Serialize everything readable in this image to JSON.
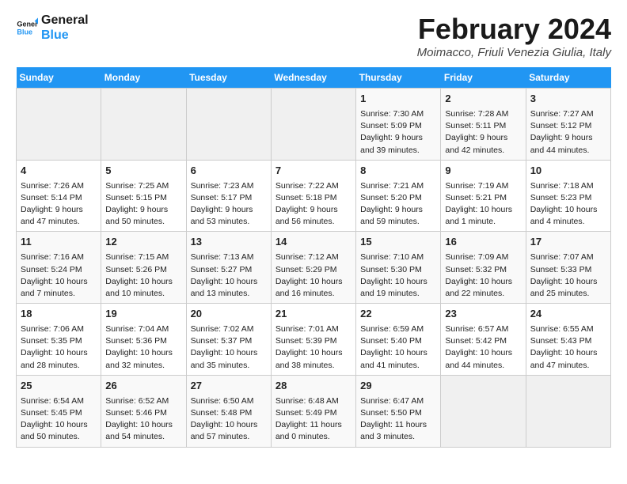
{
  "logo": {
    "line1": "General",
    "line2": "Blue"
  },
  "title": "February 2024",
  "subtitle": "Moimacco, Friuli Venezia Giulia, Italy",
  "days_of_week": [
    "Sunday",
    "Monday",
    "Tuesday",
    "Wednesday",
    "Thursday",
    "Friday",
    "Saturday"
  ],
  "weeks": [
    [
      {
        "day": "",
        "info": ""
      },
      {
        "day": "",
        "info": ""
      },
      {
        "day": "",
        "info": ""
      },
      {
        "day": "",
        "info": ""
      },
      {
        "day": "1",
        "info": "Sunrise: 7:30 AM\nSunset: 5:09 PM\nDaylight: 9 hours and 39 minutes."
      },
      {
        "day": "2",
        "info": "Sunrise: 7:28 AM\nSunset: 5:11 PM\nDaylight: 9 hours and 42 minutes."
      },
      {
        "day": "3",
        "info": "Sunrise: 7:27 AM\nSunset: 5:12 PM\nDaylight: 9 hours and 44 minutes."
      }
    ],
    [
      {
        "day": "4",
        "info": "Sunrise: 7:26 AM\nSunset: 5:14 PM\nDaylight: 9 hours and 47 minutes."
      },
      {
        "day": "5",
        "info": "Sunrise: 7:25 AM\nSunset: 5:15 PM\nDaylight: 9 hours and 50 minutes."
      },
      {
        "day": "6",
        "info": "Sunrise: 7:23 AM\nSunset: 5:17 PM\nDaylight: 9 hours and 53 minutes."
      },
      {
        "day": "7",
        "info": "Sunrise: 7:22 AM\nSunset: 5:18 PM\nDaylight: 9 hours and 56 minutes."
      },
      {
        "day": "8",
        "info": "Sunrise: 7:21 AM\nSunset: 5:20 PM\nDaylight: 9 hours and 59 minutes."
      },
      {
        "day": "9",
        "info": "Sunrise: 7:19 AM\nSunset: 5:21 PM\nDaylight: 10 hours and 1 minute."
      },
      {
        "day": "10",
        "info": "Sunrise: 7:18 AM\nSunset: 5:23 PM\nDaylight: 10 hours and 4 minutes."
      }
    ],
    [
      {
        "day": "11",
        "info": "Sunrise: 7:16 AM\nSunset: 5:24 PM\nDaylight: 10 hours and 7 minutes."
      },
      {
        "day": "12",
        "info": "Sunrise: 7:15 AM\nSunset: 5:26 PM\nDaylight: 10 hours and 10 minutes."
      },
      {
        "day": "13",
        "info": "Sunrise: 7:13 AM\nSunset: 5:27 PM\nDaylight: 10 hours and 13 minutes."
      },
      {
        "day": "14",
        "info": "Sunrise: 7:12 AM\nSunset: 5:29 PM\nDaylight: 10 hours and 16 minutes."
      },
      {
        "day": "15",
        "info": "Sunrise: 7:10 AM\nSunset: 5:30 PM\nDaylight: 10 hours and 19 minutes."
      },
      {
        "day": "16",
        "info": "Sunrise: 7:09 AM\nSunset: 5:32 PM\nDaylight: 10 hours and 22 minutes."
      },
      {
        "day": "17",
        "info": "Sunrise: 7:07 AM\nSunset: 5:33 PM\nDaylight: 10 hours and 25 minutes."
      }
    ],
    [
      {
        "day": "18",
        "info": "Sunrise: 7:06 AM\nSunset: 5:35 PM\nDaylight: 10 hours and 28 minutes."
      },
      {
        "day": "19",
        "info": "Sunrise: 7:04 AM\nSunset: 5:36 PM\nDaylight: 10 hours and 32 minutes."
      },
      {
        "day": "20",
        "info": "Sunrise: 7:02 AM\nSunset: 5:37 PM\nDaylight: 10 hours and 35 minutes."
      },
      {
        "day": "21",
        "info": "Sunrise: 7:01 AM\nSunset: 5:39 PM\nDaylight: 10 hours and 38 minutes."
      },
      {
        "day": "22",
        "info": "Sunrise: 6:59 AM\nSunset: 5:40 PM\nDaylight: 10 hours and 41 minutes."
      },
      {
        "day": "23",
        "info": "Sunrise: 6:57 AM\nSunset: 5:42 PM\nDaylight: 10 hours and 44 minutes."
      },
      {
        "day": "24",
        "info": "Sunrise: 6:55 AM\nSunset: 5:43 PM\nDaylight: 10 hours and 47 minutes."
      }
    ],
    [
      {
        "day": "25",
        "info": "Sunrise: 6:54 AM\nSunset: 5:45 PM\nDaylight: 10 hours and 50 minutes."
      },
      {
        "day": "26",
        "info": "Sunrise: 6:52 AM\nSunset: 5:46 PM\nDaylight: 10 hours and 54 minutes."
      },
      {
        "day": "27",
        "info": "Sunrise: 6:50 AM\nSunset: 5:48 PM\nDaylight: 10 hours and 57 minutes."
      },
      {
        "day": "28",
        "info": "Sunrise: 6:48 AM\nSunset: 5:49 PM\nDaylight: 11 hours and 0 minutes."
      },
      {
        "day": "29",
        "info": "Sunrise: 6:47 AM\nSunset: 5:50 PM\nDaylight: 11 hours and 3 minutes."
      },
      {
        "day": "",
        "info": ""
      },
      {
        "day": "",
        "info": ""
      }
    ]
  ]
}
